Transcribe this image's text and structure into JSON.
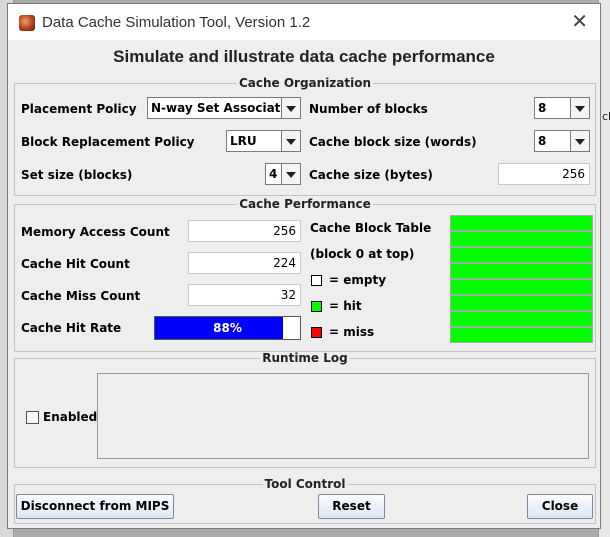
{
  "window": {
    "title": "Data Cache Simulation Tool, Version 1.2",
    "close_glyph": "✕"
  },
  "heading": "Simulate and illustrate data cache performance",
  "organization": {
    "legend": "Cache Organization",
    "placement_label": "Placement Policy",
    "placement_value": "N-way Set Associative",
    "replacement_label": "Block Replacement Policy",
    "replacement_value": "LRU",
    "set_size_label": "Set size (blocks)",
    "set_size_value": "4",
    "num_blocks_label": "Number of blocks",
    "num_blocks_value": "8",
    "block_size_label": "Cache block size (words)",
    "block_size_value": "8",
    "cache_size_label": "Cache size (bytes)",
    "cache_size_value": "256"
  },
  "performance": {
    "legend": "Cache Performance",
    "access_label": "Memory Access Count",
    "access_value": "256",
    "hit_label": "Cache Hit Count",
    "hit_value": "224",
    "miss_label": "Cache Miss Count",
    "miss_value": "32",
    "hit_rate_label": "Cache Hit Rate",
    "hit_rate_text": "88%",
    "hit_rate_fraction": 0.88,
    "block_table_label": "Cache Block Table",
    "block_table_sub": "(block 0 at top)",
    "legend_empty": "= empty",
    "legend_hit": "= hit",
    "legend_miss": "= miss",
    "colors": {
      "empty": "#ffffff",
      "hit": "#00ff00",
      "miss": "#ff0000",
      "bar": "#0000ff"
    },
    "blocks": [
      "hit",
      "hit",
      "hit",
      "hit",
      "hit",
      "hit",
      "hit",
      "hit"
    ]
  },
  "log": {
    "legend": "Runtime Log",
    "enabled_label": "Enabled",
    "enabled_checked": false
  },
  "control": {
    "legend": "Tool Control",
    "disconnect_label": "Disconnect from MIPS",
    "reset_label": "Reset",
    "close_label": "Close"
  },
  "background": {
    "right_window_fragment": "ch"
  }
}
